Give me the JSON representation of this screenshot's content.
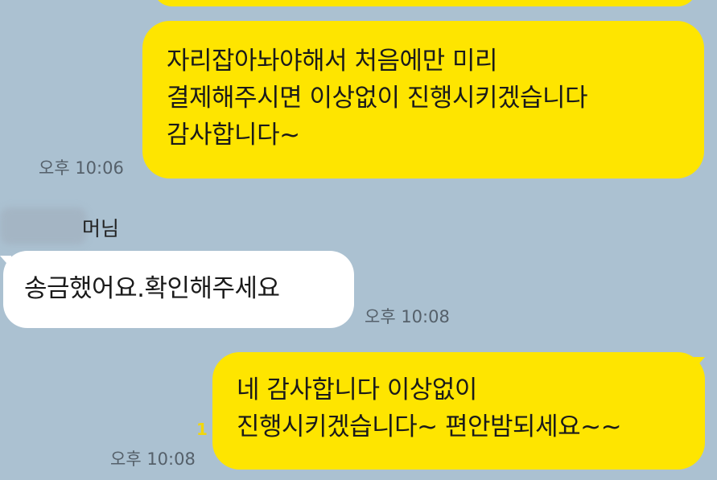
{
  "messages": [
    {
      "id": "m0",
      "sender": "me",
      "lines": []
    },
    {
      "id": "m1",
      "sender": "me",
      "lines": [
        "자리잡아놔야해서 처음에만 미리",
        "결제해주시면 이상없이 진행시키겠습니다",
        "감사합니다~"
      ],
      "time": "오후 10:06"
    },
    {
      "id": "m2",
      "sender": "other",
      "sender_name": "머님",
      "lines": [
        "송금했어요.확인해주세요"
      ],
      "time": "오후 10:08"
    },
    {
      "id": "m3",
      "sender": "me",
      "lines": [
        "네 감사합니다 이상없이",
        "진행시키겠습니다~ 편안밤되세요~~"
      ],
      "time": "오후 10:08",
      "unread_count": "1"
    }
  ],
  "colors": {
    "background": "#abc1d1",
    "my_bubble": "#fee500",
    "their_bubble": "#ffffff",
    "unread": "#f2d70b"
  }
}
